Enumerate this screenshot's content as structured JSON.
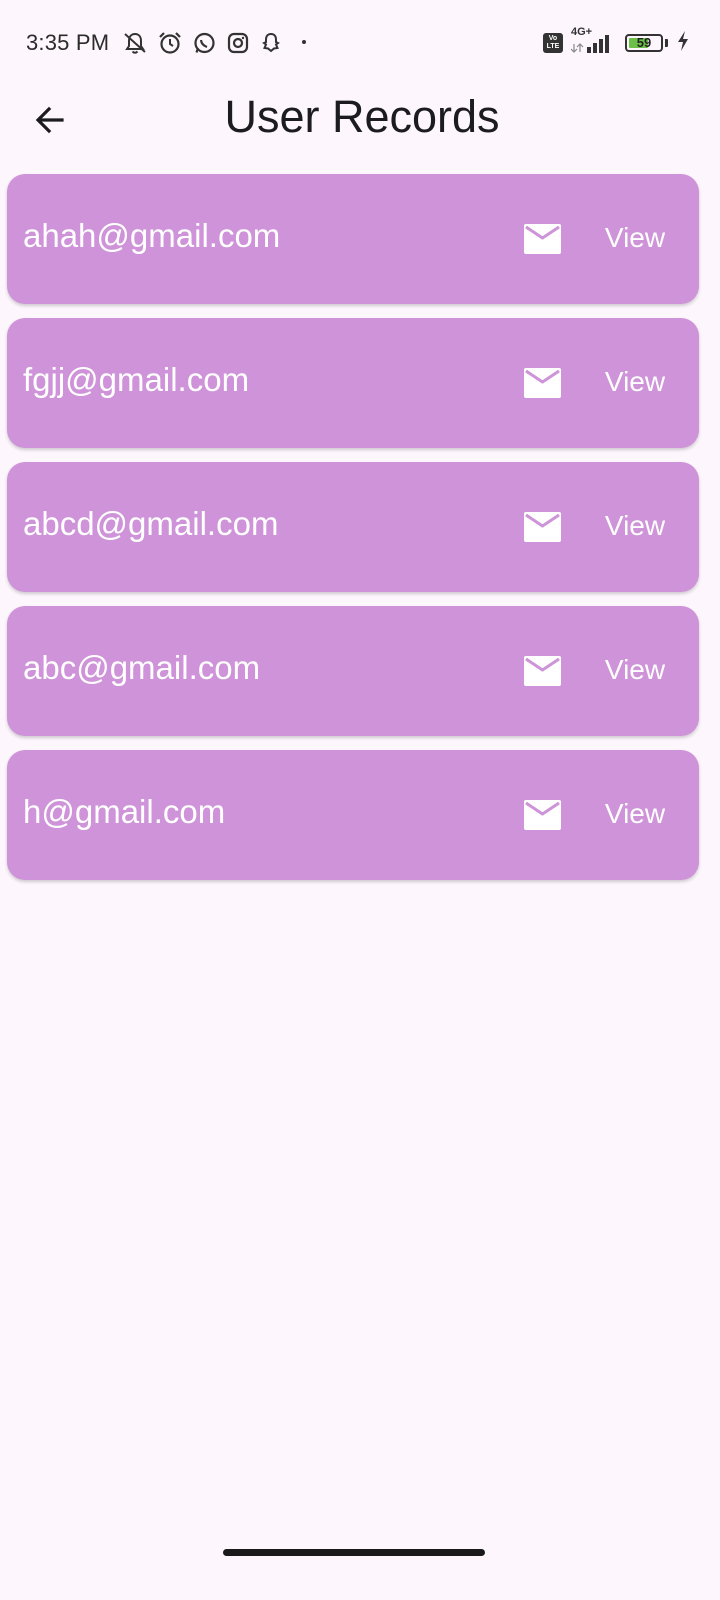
{
  "status_bar": {
    "time": "3:35 PM",
    "left_icons": [
      "bell-off-icon",
      "alarm-icon",
      "whatsapp-icon",
      "instagram-icon",
      "snapchat-icon",
      "dot-icon"
    ],
    "volte_top": "Vo",
    "volte_bottom": "LTE",
    "network_type": "4G+",
    "battery_level": "59"
  },
  "app_bar": {
    "back_icon": "arrow-left-icon",
    "title": "User Records"
  },
  "records": [
    {
      "email": "ahah@gmail.com",
      "mail_icon": "mail-icon",
      "view_label": "View"
    },
    {
      "email": "fgjj@gmail.com",
      "mail_icon": "mail-icon",
      "view_label": "View"
    },
    {
      "email": "abcd@gmail.com",
      "mail_icon": "mail-icon",
      "view_label": "View"
    },
    {
      "email": "abc@gmail.com",
      "mail_icon": "mail-icon",
      "view_label": "View"
    },
    {
      "email": "h@gmail.com",
      "mail_icon": "mail-icon",
      "view_label": "View"
    }
  ],
  "colors": {
    "background": "#fdf6fd",
    "card": "#ce93d8",
    "card_text": "#ffffff",
    "battery_fill": "#6cc04a"
  }
}
